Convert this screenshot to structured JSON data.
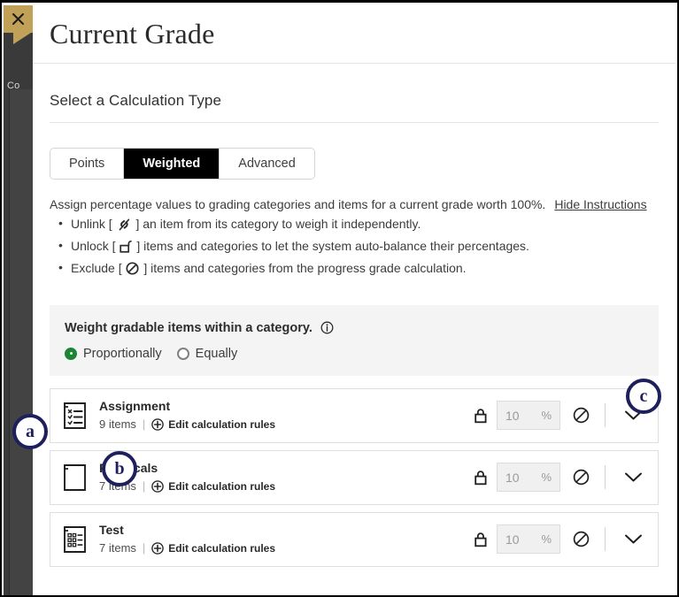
{
  "window": {
    "close_label": "×",
    "sidebar_label": "Co"
  },
  "dialog": {
    "title": "Current Grade",
    "section_heading": "Select a Calculation Type"
  },
  "tabs": [
    {
      "label": "Points",
      "active": false
    },
    {
      "label": "Weighted",
      "active": true
    },
    {
      "label": "Advanced",
      "active": false
    }
  ],
  "instructions": {
    "lead": "Assign percentage values to grading categories and items for a current grade worth 100%.",
    "toggle_link": "Hide Instructions",
    "bullets": [
      {
        "prefix": "Unlink [",
        "icon": "unlink-icon",
        "suffix": "] an item from its category to weigh it independently."
      },
      {
        "prefix": "Unlock [",
        "icon": "unlock-icon",
        "suffix": "] items and categories to let the system auto-balance their percentages."
      },
      {
        "prefix": "Exclude [",
        "icon": "exclude-icon",
        "suffix": "] items and categories from the progress grade calculation."
      }
    ]
  },
  "weight_panel": {
    "title": "Weight gradable items within a category.",
    "info_icon": "info-icon",
    "options": [
      {
        "label": "Proportionally",
        "selected": true
      },
      {
        "label": "Equally",
        "selected": false
      }
    ]
  },
  "categories": [
    {
      "name": "Assignment",
      "icon": "checklist-icon",
      "items_text": "9 items",
      "edit_link": "Edit calculation rules",
      "percent": "10",
      "percent_symbol": "%",
      "lock_icon": "lock-closed-icon",
      "exclude_icon": "exclude-icon",
      "expand_icon": "chevron-down-icon"
    },
    {
      "name": "Practicals",
      "icon": "document-blank-icon",
      "items_text": "7 items",
      "edit_link": "Edit calculation rules",
      "percent": "10",
      "percent_symbol": "%",
      "lock_icon": "lock-closed-icon",
      "exclude_icon": "exclude-icon",
      "expand_icon": "chevron-down-icon"
    },
    {
      "name": "Test",
      "icon": "grid-document-icon",
      "items_text": "7 items",
      "edit_link": "Edit calculation rules",
      "percent": "10",
      "percent_symbol": "%",
      "lock_icon": "lock-closed-icon",
      "exclude_icon": "exclude-icon",
      "expand_icon": "chevron-down-icon"
    }
  ],
  "callouts": [
    {
      "label": "a"
    },
    {
      "label": "b"
    },
    {
      "label": "c"
    }
  ],
  "colors": {
    "accent_navy": "#1f1f5c",
    "radio_green": "#1a8535",
    "close_chip_tan": "#c1a158",
    "active_tab_bg": "#000000",
    "panel_gray": "#f4f4f4"
  }
}
